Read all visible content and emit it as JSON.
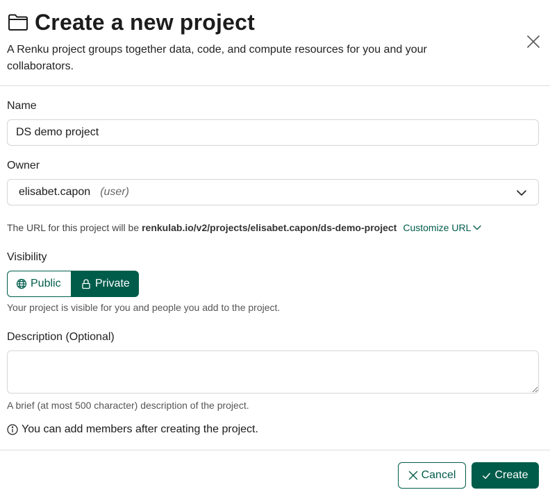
{
  "header": {
    "title": "Create a new project",
    "subtitle": "A Renku project groups together data, code, and compute resources for you and your collaborators.",
    "title_icon": "folder-icon",
    "close_icon": "close-icon"
  },
  "form": {
    "name": {
      "label": "Name",
      "value": "DS demo project"
    },
    "owner": {
      "label": "Owner",
      "value": "elisabet.capon",
      "note": "(user)",
      "icon": "chevron-down-icon"
    },
    "url": {
      "prefix": "The URL for this project will be",
      "url": "renkulab.io/v2/projects/elisabet.capon/ds-demo-project",
      "customize_label": "Customize URL"
    },
    "visibility": {
      "label": "Visibility",
      "options": [
        {
          "label": "Public",
          "icon": "globe-icon",
          "selected": false
        },
        {
          "label": "Private",
          "icon": "lock-icon",
          "selected": true
        }
      ],
      "help": "Your project is visible for you and people you add to the project."
    },
    "description": {
      "label": "Description (Optional)",
      "value": "",
      "help": "A brief (at most 500 character) description of the project."
    },
    "members_info": "You can add members after creating the project."
  },
  "footer": {
    "cancel_label": "Cancel",
    "create_label": "Create"
  },
  "colors": {
    "accent": "#005c4a",
    "border": "#d5d5d5",
    "divider": "#dcdcdc"
  }
}
